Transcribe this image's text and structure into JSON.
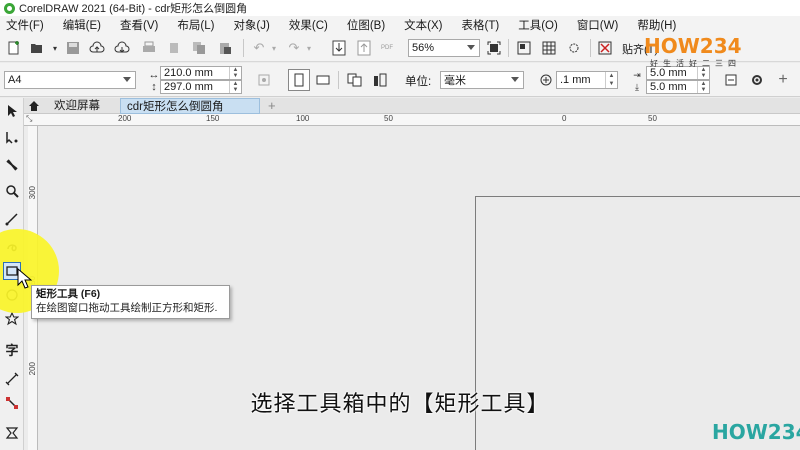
{
  "window": {
    "title": "CorelDRAW 2021 (64-Bit) - cdr矩形怎么倒圆角"
  },
  "menu": [
    "文件(F)",
    "编辑(E)",
    "查看(V)",
    "布局(L)",
    "对象(J)",
    "效果(C)",
    "位图(B)",
    "文本(X)",
    "表格(T)",
    "工具(O)",
    "窗口(W)",
    "帮助(H)"
  ],
  "toolbar": {
    "zoom": "56%",
    "snap_label": "贴齐(T)"
  },
  "property_bar": {
    "page_size": "A4",
    "width": "210.0 mm",
    "height": "297.0 mm",
    "units_label": "单位:",
    "units": "毫米",
    "nudge": ".1 mm",
    "dup_x": "5.0 mm",
    "dup_y": "5.0 mm"
  },
  "tabs": [
    "欢迎屏幕",
    "cdr矩形怎么倒圆角"
  ],
  "ruler": {
    "h_ticks": [
      "200",
      "150",
      "100",
      "50",
      "0",
      "50"
    ],
    "v_ticks": [
      "300",
      "250",
      "200"
    ]
  },
  "tooltip": {
    "title": "矩形工具 (F6)",
    "description": "在绘图窗口拖动工具绘制正方形和矩形."
  },
  "subtitle": "选择工具箱中的【矩形工具】",
  "watermark": {
    "logo_text": "HOW234",
    "slogan": "好生活好二三四"
  },
  "colors": {
    "highlight": "#faf428",
    "logo_orange": "#f08a1c",
    "logo_teal": "#2aa6a1",
    "logo_pink": "#e8467c"
  }
}
